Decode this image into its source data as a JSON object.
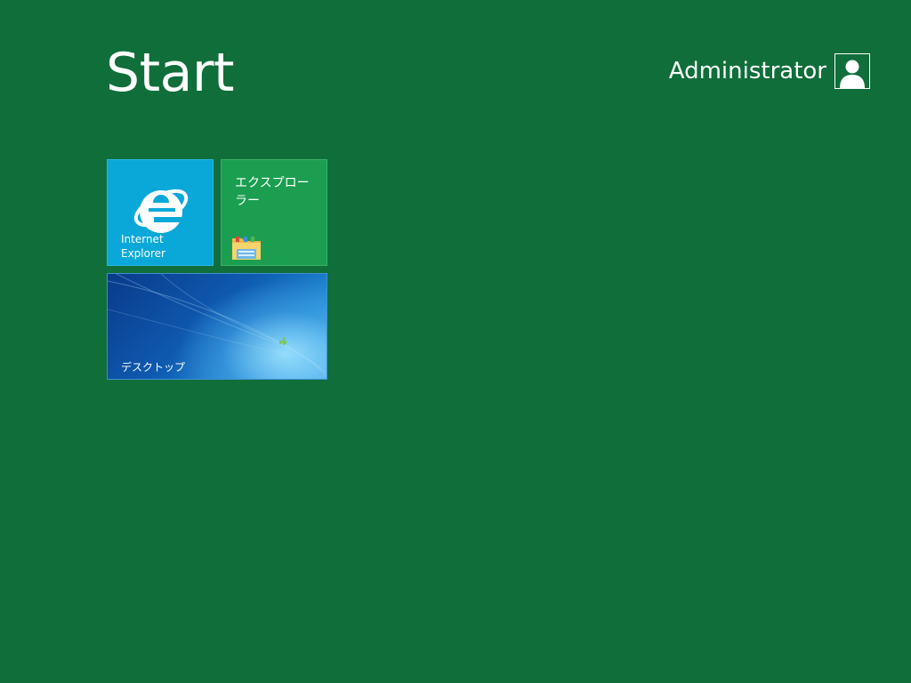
{
  "header": {
    "title": "Start",
    "user_name": "Administrator",
    "user_icon": "user-avatar-icon"
  },
  "tiles": [
    {
      "label": "Internet\nExplorer",
      "icon": "internet-explorer-icon",
      "color": "#09a8d9"
    },
    {
      "label": "エクスプローラー",
      "icon": "file-explorer-folder-icon",
      "color": "#1b9e50"
    },
    {
      "label": "デスクトップ",
      "icon": "desktop-wallpaper",
      "color": "#0e5ab0"
    }
  ],
  "colors": {
    "background": "#0f6e3a"
  }
}
